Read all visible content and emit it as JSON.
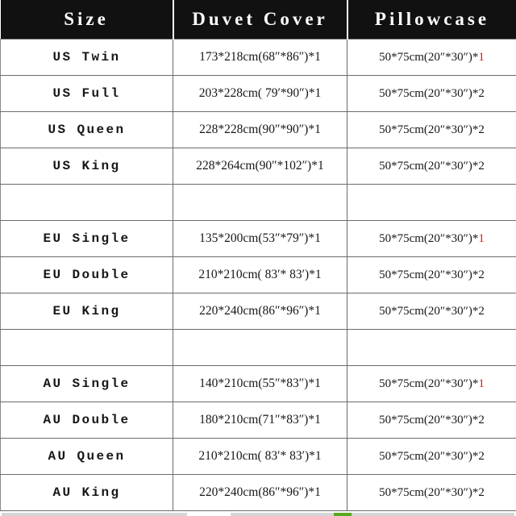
{
  "table": {
    "columns": [
      {
        "key": "size",
        "label": "Size"
      },
      {
        "key": "duvet",
        "label": "Duvet Cover"
      },
      {
        "key": "pillow",
        "label": "Pillowcase"
      }
    ],
    "accent_red": "#e81414",
    "header_background": "#111111",
    "header_text_color": "#ffffff",
    "border_color": "#6b6b6b",
    "rows": [
      {
        "type": "data",
        "size": "US Twin",
        "duvet": "173*218cm(68″*86″)*1",
        "pillow_text": "50*75cm(20″*30″)*",
        "pillow_qty": "1",
        "pillow_qty_red": true
      },
      {
        "type": "data",
        "size": "US Full",
        "duvet": "203*228cm( 79′*90″)*1",
        "pillow_text": "50*75cm(20″*30″)*",
        "pillow_qty": "2",
        "pillow_qty_red": false
      },
      {
        "type": "data",
        "size": "US Queen",
        "duvet": "228*228cm(90″*90″)*1",
        "pillow_text": "50*75cm(20″*30″)*",
        "pillow_qty": "2",
        "pillow_qty_red": false
      },
      {
        "type": "data",
        "size": "US King",
        "duvet": "228*264cm(90″*102″)*1",
        "pillow_text": "50*75cm(20″*30″)*",
        "pillow_qty": "2",
        "pillow_qty_red": false
      },
      {
        "type": "spacer",
        "size": "",
        "duvet": "",
        "pillow_text": "",
        "pillow_qty": "",
        "pillow_qty_red": false
      },
      {
        "type": "data",
        "size": "EU Single",
        "duvet": "135*200cm(53″*79″)*1",
        "pillow_text": "50*75cm(20″*30″)*",
        "pillow_qty": "1",
        "pillow_qty_red": true
      },
      {
        "type": "data",
        "size": "EU Double",
        "duvet": "210*210cm( 83′* 83′)*1",
        "pillow_text": "50*75cm(20″*30″)*",
        "pillow_qty": "2",
        "pillow_qty_red": false
      },
      {
        "type": "data",
        "size": "EU King",
        "duvet": "220*240cm(86″*96″)*1",
        "pillow_text": "50*75cm(20″*30″)*",
        "pillow_qty": "2",
        "pillow_qty_red": false
      },
      {
        "type": "spacer",
        "size": "",
        "duvet": "",
        "pillow_text": "",
        "pillow_qty": "",
        "pillow_qty_red": false
      },
      {
        "type": "data",
        "size": "AU Single",
        "duvet": "140*210cm(55″*83″)*1",
        "pillow_text": "50*75cm(20″*30″)*",
        "pillow_qty": "1",
        "pillow_qty_red": true
      },
      {
        "type": "data",
        "size": "AU Double",
        "duvet": "180*210cm(71″*83″)*1",
        "pillow_text": "50*75cm(20″*30″)*",
        "pillow_qty": "2",
        "pillow_qty_red": false
      },
      {
        "type": "data",
        "size": "AU Queen",
        "duvet": "210*210cm( 83′* 83′)*1",
        "pillow_text": "50*75cm(20″*30″)*",
        "pillow_qty": "2",
        "pillow_qty_red": false
      },
      {
        "type": "data",
        "size": "AU King",
        "duvet": "220*240cm(86″*96″)*1",
        "pillow_text": "50*75cm(20″*30″)*",
        "pillow_qty": "2",
        "pillow_qty_red": false
      }
    ]
  }
}
